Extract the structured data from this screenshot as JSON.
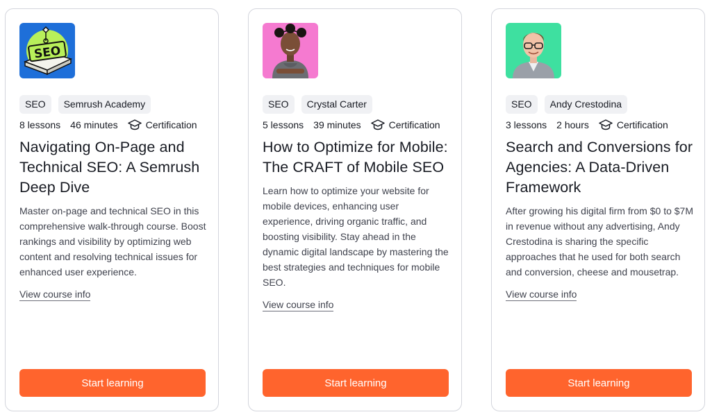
{
  "cards": [
    {
      "tags": [
        "SEO",
        "Semrush Academy"
      ],
      "lessons": "8 lessons",
      "duration": "46 minutes",
      "certification": "Certification",
      "title": "Navigating On-Page and Technical SEO: A Semrush Deep Dive",
      "description": "Master on-page and technical SEO in this comprehensive walk-through course. Boost rankings and visibility by optimizing web content and resolving technical issues for enhanced user experience.",
      "thumbnail_text": "SEO",
      "link_label": "View course info",
      "button_label": "Start learning"
    },
    {
      "tags": [
        "SEO",
        "Crystal Carter"
      ],
      "lessons": "5 lessons",
      "duration": "39 minutes",
      "certification": "Certification",
      "title": "How to Optimize for Mobile: The CRAFT of Mobile SEO",
      "description": "Learn how to optimize your website for mobile devices, enhancing user experience, driving organic traffic, and boosting visibility. Stay ahead in the dynamic digital landscape by mastering the best strategies and techniques for mobile SEO.",
      "link_label": "View course info",
      "button_label": "Start learning"
    },
    {
      "tags": [
        "SEO",
        "Andy Crestodina"
      ],
      "lessons": "3 lessons",
      "duration": "2 hours",
      "certification": "Certification",
      "title": "Search and Conversions for Agencies: A Data-Driven Framework",
      "description": "After growing his digital firm from $0 to $7M in revenue without any advertising, Andy Crestodina is sharing the specific approaches that he used for both search and conversion, cheese and mousetrap.",
      "link_label": "View course info",
      "button_label": "Start learning"
    }
  ],
  "colors": {
    "accent": "#ff642d",
    "tag_bg": "#f0f1f4",
    "border": "#d3d5dc",
    "thumb1_bg": "#1e6fd9",
    "thumb2_bg": "#f57ad0",
    "thumb3_bg": "#3ee0a0"
  }
}
